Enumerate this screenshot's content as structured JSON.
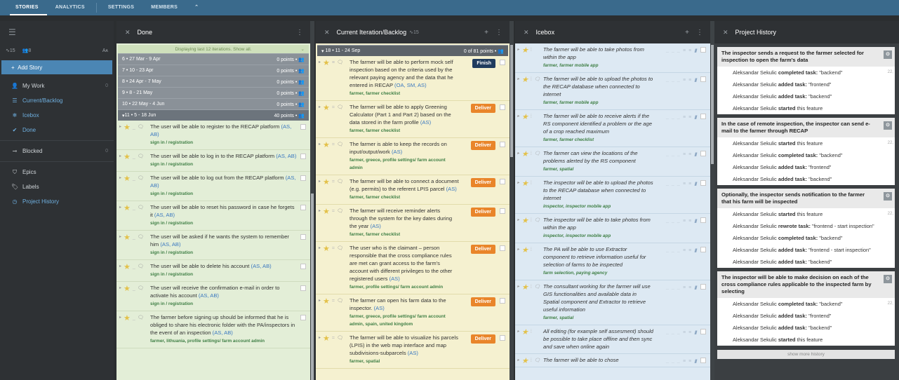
{
  "topnav": {
    "tabs": [
      "STORIES",
      "ANALYTICS",
      "SETTINGS",
      "MEMBERS"
    ],
    "more": "⌃"
  },
  "sidebar": {
    "velocity": "15",
    "members": "8",
    "add_story": "Add Story",
    "items": [
      {
        "label": "My Work",
        "count": "0",
        "icon": "user-icon"
      },
      {
        "label": "Current/Backlog",
        "icon": "list-icon"
      },
      {
        "label": "Icebox",
        "icon": "snowflake-icon"
      },
      {
        "label": "Done",
        "icon": "check-icon"
      }
    ],
    "blocked": {
      "label": "Blocked",
      "count": "0"
    },
    "items2": [
      {
        "label": "Epics",
        "icon": "epic-icon"
      },
      {
        "label": "Labels",
        "icon": "tag-icon"
      },
      {
        "label": "Project History",
        "icon": "history-icon"
      }
    ]
  },
  "done": {
    "title": "Done",
    "banner": "Displaying last 12 iterations. Show all.",
    "iterations": [
      {
        "label": "6 • 27 Mar - 9 Apr",
        "points": "0 points •"
      },
      {
        "label": "7 • 10 - 23 Apr",
        "points": "0 points •"
      },
      {
        "label": "8 • 24 Apr - 7 May",
        "points": "0 points •"
      },
      {
        "label": "9 • 8 - 21 May",
        "points": "0 points •"
      },
      {
        "label": "10 • 22 May - 4 Jun",
        "points": "0 points •"
      },
      {
        "label": "11 • 5 - 18 Jun",
        "points": "40 points •"
      }
    ],
    "stories": [
      {
        "text": "The user will be able to register to the RECAP platform",
        "owners": "(AS, AB)",
        "labels": "sign in / registration"
      },
      {
        "text": "The user will be able to log in to the RECAP platform",
        "owners": "(AS, AB)",
        "labels": "sign in / registration"
      },
      {
        "text": "The user will be able to log out from the RECAP platform",
        "owners": "(AS, AB)",
        "labels": "sign in / registration"
      },
      {
        "text": "The user will be able to reset his password in case he forgets it",
        "owners": "(AS, AB)",
        "labels": "sign in / registration"
      },
      {
        "text": "The user will be asked if he wants the system to remember him",
        "owners": "(AS, AB)",
        "labels": "sign in / registration"
      },
      {
        "text": "The user will be able to delete his account",
        "owners": "(AS, AB)",
        "labels": "sign in / registration"
      },
      {
        "text": "The user will receive the confirmation e-mail in order to activate his account",
        "owners": "(AS, AB)",
        "labels": "sign in / registration"
      },
      {
        "text": "The farmer before signing up should be informed that he is obliged to share his electronic folder with the PA/inspectors in the event of an inspection",
        "owners": "(AS, AB)",
        "labels": "farmer, lithuania, profile settings/ farm account admin"
      }
    ]
  },
  "current": {
    "title": "Current Iteration/Backlog",
    "velocity": "15",
    "iteration": {
      "label": "18 • 11 - 24 Sep",
      "points": "0 of 81 points •"
    },
    "stories": [
      {
        "text": "The farmer will be able to perform mock self inspection based on the criteria used by the relevant paying agency and the data that he entered in RECAP",
        "owners": "(OA, SM, AS)",
        "labels": "farmer, farmer checklist",
        "button": "Finish",
        "kind": "finish"
      },
      {
        "text": "The farmer will be able to apply Greening Calculator (Part 1 and Part 2) based on the data stored in the farm profile",
        "owners": "(AS)",
        "labels": "farmer, farmer checklist",
        "button": "Deliver",
        "kind": "deliver"
      },
      {
        "text": "The farmer is able to keep the records on input/output/work",
        "owners": "(AS)",
        "labels": "farmer, greece, profile settings/ farm account admin",
        "button": "Deliver",
        "kind": "deliver"
      },
      {
        "text": "The farmer will be able to connect a document (e.g. permits) to the referent LPIS parcel",
        "owners": "(AS)",
        "labels": "farmer, farmer checklist",
        "button": "Deliver",
        "kind": "deliver"
      },
      {
        "text": "The farmer will receive reminder alerts through the system for the key dates during the year",
        "owners": "(AS)",
        "labels": "farmer, farmer checklist",
        "button": "Deliver",
        "kind": "deliver"
      },
      {
        "text": "The user who is the claimant – person responsible that the cross compliance rules are met can grant access to the farm's account with different privileges to the other registered users",
        "owners": "(AS)",
        "labels": "farmer, profile settings/ farm account admin",
        "button": "Deliver",
        "kind": "deliver"
      },
      {
        "text": "The farmer can open his farm data to the inspector.",
        "owners": "(AS)",
        "labels": "farmer, greece, profile settings/ farm account admin, spain, united kingdom",
        "button": "Deliver",
        "kind": "deliver"
      },
      {
        "text": "The farmer will be able to visualize his parcels (LPIS) in the web map interface and map subdivisions-subparcels",
        "owners": "(AS)",
        "labels": "farmer, spatial",
        "button": "Deliver",
        "kind": "deliver"
      }
    ]
  },
  "icebox": {
    "title": "Icebox",
    "stories": [
      {
        "text": "The farmer will be able to take photos from within the app",
        "labels": "farmer, farmer mobile app"
      },
      {
        "text": "The farmer will be able to upload the photos to the RECAP database when connected to internet",
        "labels": "farmer, farmer mobile app"
      },
      {
        "text": "The farmer will be able to receive alerts if the RS component identified a problem or the age of a crop reached maximum",
        "labels": "farmer, farmer checklist"
      },
      {
        "text": "The farmer can view the locations of the problems alerted by the RS component",
        "labels": "farmer, spatial"
      },
      {
        "text": "The inspector will be able to upload the photos to the RECAP database when connected to internet",
        "labels": "inspector, inspector mobile app"
      },
      {
        "text": "The inspector will be able to take photos from within the app",
        "labels": "inspector, inspector mobile app"
      },
      {
        "text": "The PA will be able to use Extractor component to retrieve information useful for selection of farms to be inspected",
        "labels": "farm selection, paying agency"
      },
      {
        "text": "The consultant working for the farmer will use GIS functionalities and available data in Spatial component and Extractor to retrieve useful information",
        "labels": "farmer, spatial"
      },
      {
        "text": "All editing (for example self assesment) should be possible to take place offline and then sync and save when online again",
        "labels": ""
      },
      {
        "text": "The farmer will be able to chose",
        "labels": ""
      }
    ]
  },
  "history": {
    "title": "Project History",
    "cards": [
      {
        "title": "The inspector sends a request to the farmer selected for inspection to open the farm's data",
        "rows": [
          {
            "who": "Aleksandar Sekulic",
            "action": "completed task:",
            "detail": "\"backend\"",
            "time": "22,"
          },
          {
            "who": "Aleksandar Sekulic",
            "action": "added task:",
            "detail": "\"frontend\"",
            "time": ""
          },
          {
            "who": "Aleksandar Sekulic",
            "action": "added task:",
            "detail": "\"backend\"",
            "time": ""
          },
          {
            "who": "Aleksandar Sekulic",
            "action": "started",
            "detail": "this feature",
            "time": ""
          }
        ]
      },
      {
        "title": "In the case of remote inspection, the inspector can send e-mail to the farmer through RECAP",
        "rows": [
          {
            "who": "Aleksandar Sekulic",
            "action": "started",
            "detail": "this feature",
            "time": "22,"
          },
          {
            "who": "Aleksandar Sekulic",
            "action": "completed task:",
            "detail": "\"backend\"",
            "time": ""
          },
          {
            "who": "Aleksandar Sekulic",
            "action": "added task:",
            "detail": "\"frontend\"",
            "time": ""
          },
          {
            "who": "Aleksandar Sekulic",
            "action": "added task:",
            "detail": "\"backend\"",
            "time": ""
          }
        ]
      },
      {
        "title": "Optionally, the inspector sends notification to the farmer that his farm will be inspected",
        "rows": [
          {
            "who": "Aleksandar Sekulic",
            "action": "started",
            "detail": "this feature",
            "time": "22,"
          },
          {
            "who": "Aleksandar Sekulic",
            "action": "rewrote task:",
            "detail": "\"frontend - start inspection\"",
            "time": ""
          },
          {
            "who": "Aleksandar Sekulic",
            "action": "completed task:",
            "detail": "\"backend\"",
            "time": ""
          },
          {
            "who": "Aleksandar Sekulic",
            "action": "added task:",
            "detail": "\"frontend - start inspection\"",
            "time": ""
          },
          {
            "who": "Aleksandar Sekulic",
            "action": "added task:",
            "detail": "\"backend\"",
            "time": ""
          }
        ]
      },
      {
        "title": "The inspector will be able to make decision on each of the cross compliance rules applicable to the inspected farm by selecting",
        "rows": [
          {
            "who": "Aleksandar Sekulic",
            "action": "completed task:",
            "detail": "\"backend\"",
            "time": "22,"
          },
          {
            "who": "Aleksandar Sekulic",
            "action": "added task:",
            "detail": "\"frontend\"",
            "time": ""
          },
          {
            "who": "Aleksandar Sekulic",
            "action": "added task:",
            "detail": "\"backend\"",
            "time": ""
          },
          {
            "who": "Aleksandar Sekulic",
            "action": "started",
            "detail": "this feature",
            "time": ""
          }
        ]
      }
    ],
    "show_more": "show more history"
  }
}
